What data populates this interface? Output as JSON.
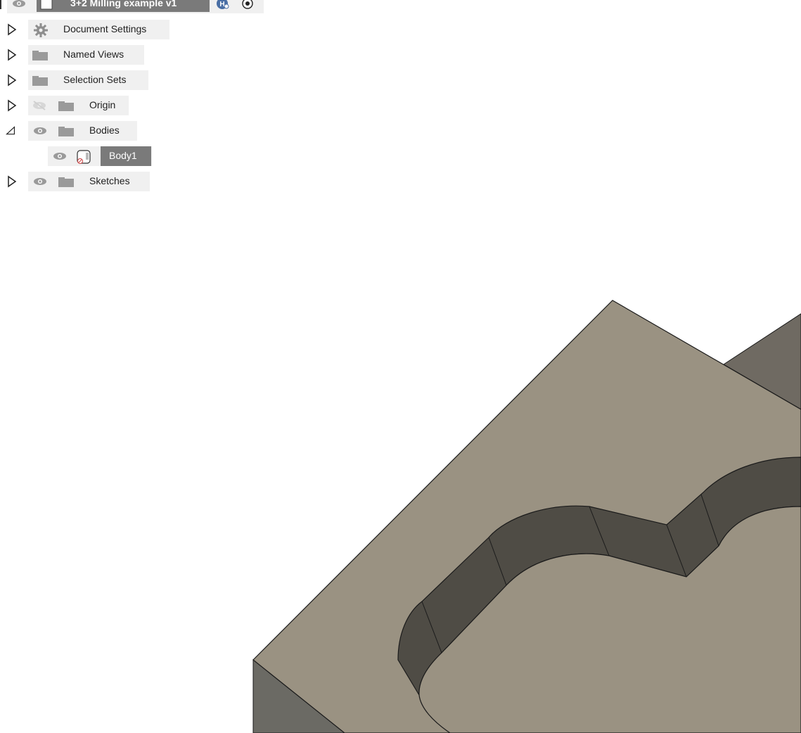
{
  "browser": {
    "root": {
      "label": "3+2 Milling example v1"
    },
    "items": [
      {
        "label": "Document Settings",
        "expanded": false
      },
      {
        "label": "Named Views",
        "expanded": false
      },
      {
        "label": "Selection Sets",
        "expanded": false
      },
      {
        "label": "Origin",
        "expanded": false,
        "visible": false
      },
      {
        "label": "Bodies",
        "expanded": true,
        "visible": true,
        "children": [
          {
            "label": "Body1",
            "selected": true,
            "visible": true
          }
        ]
      },
      {
        "label": "Sketches",
        "expanded": false,
        "visible": true
      }
    ]
  },
  "colors": {
    "model_top": "#9a9282",
    "model_wall_dark": "#4f4c45",
    "model_side": "#6e6c66",
    "selected_bg": "#7a7a7a"
  }
}
